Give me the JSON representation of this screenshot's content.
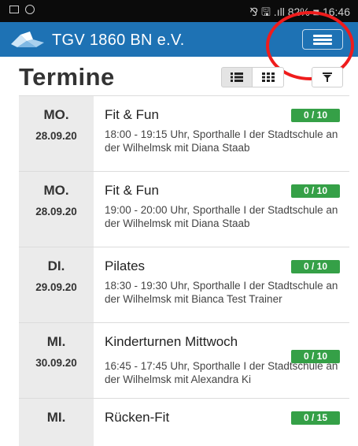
{
  "status_bar": {
    "text": "⅋ 🖫 .ıll 82% ■ 16:46"
  },
  "app": {
    "title": "TGV 1860 BN e.V."
  },
  "page": {
    "title": "Termine"
  },
  "events": [
    {
      "day": "MO.",
      "date": "28.09.20",
      "course": "Fit & Fun",
      "capacity": "0 / 10",
      "description": "18:00 - 19:15 Uhr, Sporthalle I der Stadtschule an der Wilhelmsk mit Diana Staab"
    },
    {
      "day": "MO.",
      "date": "28.09.20",
      "course": "Fit & Fun",
      "capacity": "0 / 10",
      "description": "19:00 - 20:00 Uhr, Sporthalle I der Stadtschule an der Wilhelmsk mit Diana Staab"
    },
    {
      "day": "DI.",
      "date": "29.09.20",
      "course": "Pilates",
      "capacity": "0 / 10",
      "description": "18:30 - 19:30 Uhr, Sporthalle I der Stadtschule an der Wilhelmsk mit Bianca Test Trainer"
    },
    {
      "day": "MI.",
      "date": "30.09.20",
      "course": "Kinderturnen Mittwoch",
      "capacity": "0 / 10",
      "description": "16:45 - 17:45 Uhr, Sporthalle I der Stadtschule an der Wilhelmsk mit Alexandra Ki"
    },
    {
      "day": "MI.",
      "date": "",
      "course": "Rücken-Fit",
      "capacity": "0 / 15",
      "description": ""
    }
  ],
  "colors": {
    "appbar": "#1e72b4",
    "badge": "#35a047",
    "date_column": "#ebebeb",
    "highlight_circle": "#ef1c1c"
  }
}
